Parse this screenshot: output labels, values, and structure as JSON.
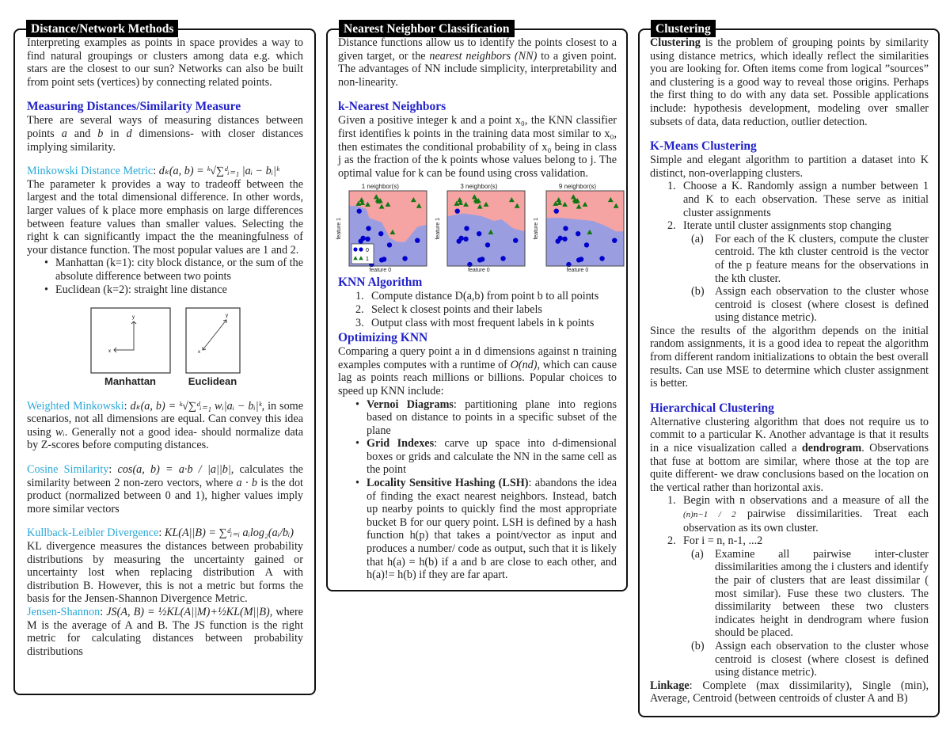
{
  "panels": {
    "distance": {
      "title": "Distance/Network Methods",
      "intro": "Interpreting examples as points in space provides a way to find natural groupings or clusters among data e.g. which stars are the closest to our sun? Networks can also be built from point sets (vertices) by connecting related points.",
      "measuring_heading": "Measuring Distances/Similarity Measure",
      "measuring_text_1": "There are several ways of measuring distances between points ",
      "measuring_a": "a",
      "measuring_and": " and ",
      "measuring_b": "b",
      "measuring_in": " in ",
      "measuring_d": "d",
      "measuring_text_2": " dimensions- with closer distances implying similarity.",
      "minkowski_label": "Minkowski Distance Metric",
      "minkowski_formula": "dₖ(a, b) = ᵏ√∑ᵈᵢ₌₁ |aᵢ − bᵢ|ᵏ",
      "minkowski_text": "The parameter k provides a way to tradeoff between the largest and the total dimensional difference. In other words, larger values of k place more emphasis on large differences between feature values than smaller values. Selecting the right k can significantly impact the the meaningfulness of your distance function. The most popular values are 1 and 2.",
      "minkowski_bullets": [
        "Manhattan (k=1): city block distance, or the sum of the absolute difference between two points",
        "Euclidean (k=2): straight line distance"
      ],
      "figures": [
        {
          "caption": "Manhattan",
          "x_label": "x",
          "y_label": "y"
        },
        {
          "caption": "Euclidean",
          "x_label": "x",
          "y_label": "y"
        }
      ],
      "weighted_label": "Weighted Minkowski",
      "weighted_formula": "dₖ(a, b) = ᵏ√∑ᵈᵢ₌₁ wᵢ|aᵢ − bᵢ|ᵏ",
      "weighted_text_1": ", in some scenarios, not all dimensions are equal. Can convey this idea using ",
      "weighted_wi": "wᵢ",
      "weighted_text_2": ". Generally not a good idea- should normalize data by Z-scores before computing distances.",
      "cosine_label": "Cosine Similarity",
      "cosine_formula": "cos(a, b) = a·b / |a||b|",
      "cosine_text_1": ", calculates the similarity between 2 non-zero vectors, where ",
      "cosine_ab": "a · b",
      "cosine_text_2": " is the dot product (normalized between 0 and 1), higher values imply more similar vectors",
      "kl_label": "Kullback-Leibler Divergence",
      "kl_formula": "KL(A||B) = ∑ᵈᵢ₌ᵢ aᵢlog₂(aᵢ/bᵢ)",
      "kl_text": "KL divergence measures the distances between probability distributions by measuring the uncertainty gained or uncertainty lost when replacing distribution A with distribution B. However, this is not a metric but forms the basis for the Jensen-Shannon Divergence Metric.",
      "js_label": "Jensen-Shannon",
      "js_formula": "JS(A, B) = ½KL(A||M)+½KL(M||B)",
      "js_text": ", where M is the average of A and B. The JS function is the right metric for calculating distances between probability distributions"
    },
    "nn": {
      "title": "Nearest Neighbor Classification",
      "intro_1": "Distance functions allow us to identify the points closest to a given target, or the ",
      "intro_em": "nearest neighbors (NN)",
      "intro_2": " to a given point. The advantages of NN include simplicity, interpretability and non-linearity.",
      "knn_heading": "k-Nearest Neighbors",
      "knn_text": "Given a positive integer k and a point x₀, the KNN classifier first identifies k points in the training data most similar to x₀, then estimates the conditional probability of x₀ being in class j as the fraction of the k points whose values belong to j. The optimal value for k can be found using cross validation.",
      "algo_heading": "KNN Algorithm",
      "algo_steps": [
        "Compute distance D(a,b) from point b to all points",
        "Select k closest points and their labels",
        "Output class with most frequent labels in k points"
      ],
      "opt_heading": "Optimizing KNN",
      "opt_text_1": "Comparing a query point a in d dimensions against n training examples computes with a runtime of ",
      "opt_math": "O(nd)",
      "opt_text_2": ", which can cause lag as points reach millions or billions. Popular choices to speed up KNN include:",
      "opt_bullets": [
        {
          "term": "Vernoi Diagrams",
          "text": ": partitioning plane into regions based on distance to points in a specific subset of the plane"
        },
        {
          "term": "Grid Indexes",
          "text": ": carve up space into d-dimensional boxes or grids and calculate the NN in the same cell as the point"
        },
        {
          "term": "Locality Sensitive Hashing (LSH)",
          "text": ": abandons the idea of finding the exact nearest neighbors. Instead, batch up nearby points to quickly find the most appropriate bucket B for our query point. LSH is defined by a hash function h(p) that takes a point/vector as input and produces a number/ code as output, such that it is likely that h(a) = h(b) if a and b are close to each other, and h(a)!= h(b) if they are far apart."
        }
      ]
    },
    "clustering": {
      "title": "Clustering",
      "intro_bold": "Clustering",
      "intro": " is the problem of grouping points by similarity using distance metrics, which ideally reflect the similarities you are looking for. Often items come from logical ”sources” and clustering is a good way to reveal those origins. Perhaps the first thing to do with any data set. Possible applications include: hypothesis development, modeling over smaller subsets of data, data reduction, outlier detection.",
      "kmeans_heading": "K-Means Clustering",
      "kmeans_intro": "Simple and elegant algorithm to partition a dataset into K distinct, non-overlapping clusters.",
      "kmeans_steps": [
        {
          "text": "Choose a K. Randomly assign a number between 1 and K to each observation. These serve as initial cluster assignments",
          "sub": []
        },
        {
          "text": "Iterate until cluster assignments stop changing",
          "sub": [
            "For each of the K clusters, compute the cluster centroid. The kth cluster centroid is the vector of the p feature means for the observations in the kth cluster.",
            "Assign each observation to the cluster whose centroid is closest (where closest is defined using distance metric)."
          ]
        }
      ],
      "kmeans_outro": "Since the results of the algorithm depends on the initial random assignments, it is a good idea to repeat the algorithm from different random initializations to obtain the best overall results. Can use MSE to determine which cluster assignment is better.",
      "hier_heading": "Hierarchical Clustering",
      "hier_intro_1": "Alternative clustering algorithm that does not require us to commit to a particular K. Another advantage is that it results in a nice visualization called a ",
      "hier_intro_bold": "dendrogram",
      "hier_intro_2": ". Observations that fuse at bottom are similar, where those at the top are quite different- we draw conclusions based on the location on the vertical rather than horizontal axis.",
      "hier_step1_frac": "(n)n−1 / 2",
      "hier_step1_a": "Begin with n observations and a measure of all the ",
      "hier_step1_b": " pairwise dissimilarities. Treat each observation as its own cluster.",
      "hier_step2": "For i = n, n-1, ...2",
      "hier_step2_sub": [
        "Examine all pairwise inter-cluster dissimilarities among the i clusters and identify the pair of clusters that are least dissimilar ( most similar). Fuse these two clusters. The dissimilarity between these two clusters indicates height in dendrogram where fusion should be placed.",
        "Assign each observation to the cluster whose centroid is closest (where closest is defined using distance metric)."
      ],
      "linkage_bold": "Linkage",
      "linkage_text": ": Complete (max dissimilarity), Single (min), Average, Centroid (between centroids of cluster A and B)"
    }
  },
  "knn_figure": {
    "xlabel": "feature 0",
    "ylabel": "feature 1",
    "legend": [
      "0",
      "1"
    ],
    "colors": {
      "class0": "#0000cc",
      "class1": "#117711",
      "region0": "#9a9ee0",
      "region1": "#f5a3a3"
    },
    "plots": [
      {
        "title": "1 neighbor(s)",
        "boundary": [
          [
            0,
            0.8
          ],
          [
            0.1,
            0.8
          ],
          [
            0.22,
            0.76
          ],
          [
            0.26,
            0.64
          ],
          [
            0.42,
            0.58
          ],
          [
            0.52,
            0.38
          ],
          [
            0.62,
            0.32
          ],
          [
            0.72,
            0.32
          ],
          [
            0.88,
            0.52
          ],
          [
            1,
            0.55
          ]
        ]
      },
      {
        "title": "3 neighbor(s)",
        "boundary": [
          [
            0,
            0.66
          ],
          [
            0.2,
            0.7
          ],
          [
            0.35,
            0.68
          ],
          [
            0.45,
            0.66
          ],
          [
            0.6,
            0.6
          ],
          [
            0.7,
            0.62
          ],
          [
            0.85,
            0.5
          ],
          [
            1,
            0.46
          ]
        ]
      },
      {
        "title": "9 neighbor(s)",
        "boundary": [
          [
            0,
            0.64
          ],
          [
            0.2,
            0.64
          ],
          [
            0.4,
            0.62
          ],
          [
            0.6,
            0.6
          ],
          [
            0.75,
            0.54
          ],
          [
            0.9,
            0.46
          ],
          [
            1,
            0.46
          ]
        ]
      }
    ],
    "points_class0": [
      [
        0.13,
        0.73
      ],
      [
        0.25,
        0.5
      ],
      [
        0.18,
        0.37
      ],
      [
        0.15,
        0.33
      ],
      [
        0.24,
        0.36
      ],
      [
        0.41,
        0.43
      ],
      [
        0.52,
        0.28
      ],
      [
        0.42,
        0.08
      ],
      [
        0.45,
        0.09
      ],
      [
        0.29,
        0.02
      ],
      [
        0.72,
        0.1
      ],
      [
        0.88,
        0.34
      ]
    ],
    "points_class1": [
      [
        0.12,
        0.83
      ],
      [
        0.17,
        0.84
      ],
      [
        0.16,
        0.88
      ],
      [
        0.35,
        0.92
      ],
      [
        0.37,
        0.88
      ],
      [
        0.38,
        0.86
      ],
      [
        0.4,
        0.87
      ],
      [
        0.24,
        0.82
      ],
      [
        0.42,
        0.79
      ],
      [
        0.5,
        0.82
      ],
      [
        0.83,
        0.88
      ],
      [
        0.9,
        0.8
      ],
      [
        0.56,
        0.45
      ]
    ]
  }
}
